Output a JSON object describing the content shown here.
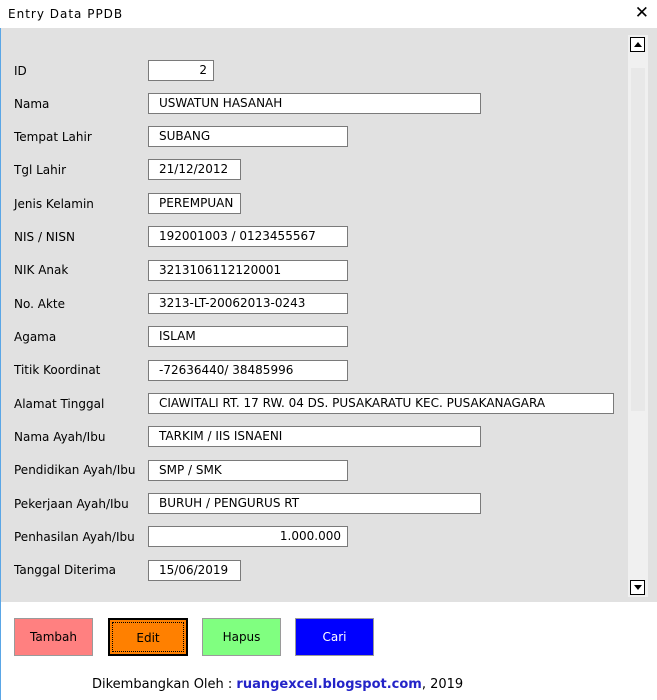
{
  "window": {
    "title": "Entry Data PPDB",
    "close_glyph": "✕"
  },
  "fields": [
    {
      "id": "id",
      "label": "ID",
      "value": "2"
    },
    {
      "id": "nama",
      "label": "Nama",
      "value": "USWATUN HASANAH"
    },
    {
      "id": "tempat-lahir",
      "label": "Tempat Lahir",
      "value": "SUBANG"
    },
    {
      "id": "tgl-lahir",
      "label": "Tgl Lahir",
      "value": "21/12/2012"
    },
    {
      "id": "jenis-kelamin",
      "label": "Jenis Kelamin",
      "value": "PEREMPUAN"
    },
    {
      "id": "nis-nisn",
      "label": "NIS / NISN",
      "value": "192001003 / 0123455567"
    },
    {
      "id": "nik-anak",
      "label": "NIK Anak",
      "value": "3213106112120001"
    },
    {
      "id": "no-akte",
      "label": "No. Akte",
      "value": "3213-LT-20062013-0243"
    },
    {
      "id": "agama",
      "label": "Agama",
      "value": "ISLAM"
    },
    {
      "id": "titik-koordinat",
      "label": "Titik Koordinat",
      "value": "-72636440/ 38485996"
    },
    {
      "id": "alamat-tinggal",
      "label": "Alamat Tinggal",
      "value": "CIAWITALI RT. 17 RW. 04 DS. PUSAKARATU KEC. PUSAKANAGARA"
    },
    {
      "id": "nama-ayah-ibu",
      "label": "Nama Ayah/Ibu",
      "value": "TARKIM / IIS ISNAENI"
    },
    {
      "id": "pendidikan-ayah-ibu",
      "label": "Pendidikan Ayah/Ibu",
      "value": "SMP / SMK"
    },
    {
      "id": "pekerjaan-ayah-ibu",
      "label": "Pekerjaan Ayah/Ibu",
      "value": "BURUH / PENGURUS RT"
    },
    {
      "id": "penghasilan-ayah-ibu",
      "label": "Penhasilan Ayah/Ibu",
      "value": "1.000.000"
    },
    {
      "id": "tanggal-diterima",
      "label": "Tanggal Diterima",
      "value": "15/06/2019"
    }
  ],
  "buttons": [
    {
      "id": "tambah",
      "label": "Tambah",
      "color": "#ff8080"
    },
    {
      "id": "edit",
      "label": "Edit",
      "color": "#ff8000"
    },
    {
      "id": "hapus",
      "label": "Hapus",
      "color": "#80ff80"
    },
    {
      "id": "cari",
      "label": "Cari",
      "color": "#0000ff"
    }
  ],
  "footer": {
    "prefix": "Dikembangkan Oleh : ",
    "link": "ruangexcel.blogspot.com",
    "suffix": ", 2019",
    "link_color": "#2424c8"
  }
}
